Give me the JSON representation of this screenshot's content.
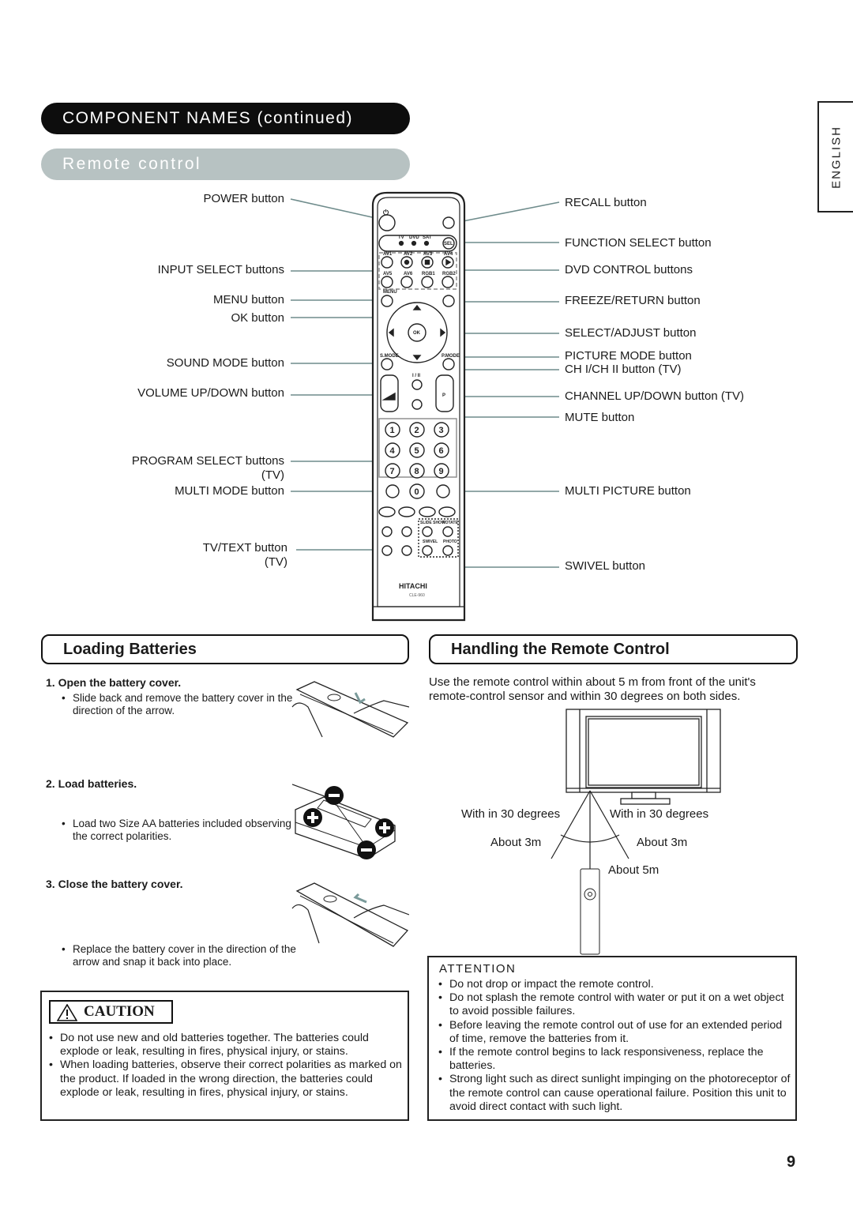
{
  "header": {
    "title": "COMPONENT NAMES (continued)",
    "subtitle": "Remote control",
    "language_tab": "ENGLISH"
  },
  "remote": {
    "brand": "HITACHI",
    "model": "CLE-960",
    "key_labels": {
      "tv": "TV",
      "dvd": "DVD",
      "sat": "SAT",
      "sel": "SEL",
      "av1": "AV1",
      "av2": "AV2",
      "av3": "AV3",
      "av4": "AV4",
      "av5": "AV5",
      "av6": "AV6",
      "rgb1": "RGB1",
      "rgb2": "RGB2",
      "menu": "MENU",
      "ok": "OK",
      "smode": "S.MODE",
      "pmode": "P.MODE",
      "ch": "I / II",
      "p": "P",
      "slideshow": "SLIDE SHOW",
      "rotate": "ROTATE",
      "swivel": "SWIVEL",
      "photo": "PHOTO",
      "digits": [
        "1",
        "2",
        "3",
        "4",
        "5",
        "6",
        "7",
        "8",
        "9",
        "0"
      ]
    },
    "left_labels": [
      {
        "text": "POWER button"
      },
      {
        "text": "INPUT SELECT buttons"
      },
      {
        "text": "MENU button"
      },
      {
        "text": "OK button"
      },
      {
        "text": "SOUND MODE button"
      },
      {
        "text": "VOLUME UP/DOWN button"
      },
      {
        "text": "PROGRAM SELECT buttons",
        "note": "(TV)"
      },
      {
        "text": "MULTI MODE button"
      },
      {
        "text": "TV/TEXT button",
        "note": "(TV)"
      }
    ],
    "right_labels": [
      {
        "text": "RECALL button"
      },
      {
        "text": "FUNCTION SELECT button"
      },
      {
        "text": "DVD CONTROL buttons"
      },
      {
        "text": "FREEZE/RETURN button"
      },
      {
        "text": "SELECT/ADJUST button"
      },
      {
        "text": "PICTURE MODE button"
      },
      {
        "text": "CH I/CH II button (TV)"
      },
      {
        "text": "CHANNEL UP/DOWN button (TV)"
      },
      {
        "text": "MUTE button"
      },
      {
        "text": "MULTI PICTURE button"
      },
      {
        "text": "SWIVEL button"
      }
    ]
  },
  "loading": {
    "title": "Loading Batteries",
    "steps": [
      {
        "title": "1.  Open the battery cover.",
        "body": "Slide back and remove the battery cover in the direction of the arrow."
      },
      {
        "title": "2.  Load batteries.",
        "body": "Load two Size AA batteries included observing the correct polarities."
      },
      {
        "title": "3.  Close the battery cover.",
        "body": "Replace the battery cover in the direction of the arrow and snap it back into place."
      }
    ]
  },
  "caution": {
    "label": "CAUTION",
    "items": [
      "Do not use new and old batteries together. The batteries could explode or leak, resulting in fires, physical injury, or stains.",
      "When loading batteries, observe their correct polarities as marked on the product. If loaded in the wrong direction, the batteries could explode or leak, resulting in fires, physical injury, or stains."
    ]
  },
  "handling": {
    "title": "Handling the Remote Control",
    "intro": "Use the remote control within about 5 m from front of the unit's remote-control sensor and within 30 degrees on both sides.",
    "diagram": {
      "angle_left": "With in 30 degrees",
      "angle_right": "With in 30 degrees",
      "dist_left": "About 3m",
      "dist_right": "About 3m",
      "dist_center": "About 5m"
    }
  },
  "attention": {
    "title": "ATTENTION",
    "items": [
      "Do not drop or impact the remote control.",
      "Do not splash the remote control with water or put it on a wet object to avoid possible failures.",
      "Before leaving the remote control out of use for an extended period of time, remove the batteries from it.",
      "If the remote control begins to lack responsiveness, replace the batteries.",
      "Strong light such as direct sunlight impinging on the photoreceptor of the remote control can cause operational failure. Position this unit to avoid direct contact with such light."
    ]
  },
  "page_number": "9"
}
